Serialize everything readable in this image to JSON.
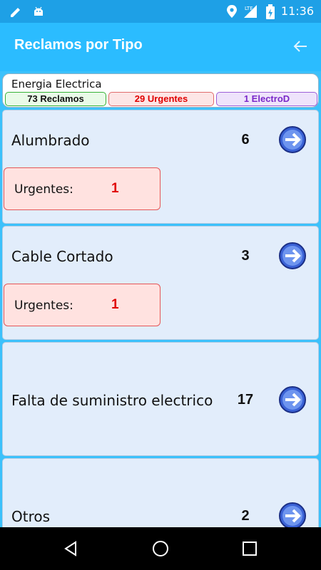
{
  "status_bar": {
    "time": "11:36",
    "network": "LTE"
  },
  "app_bar": {
    "title": "Reclamos por Tipo"
  },
  "summary": {
    "category": "Energia Electrica",
    "total_label": "73 Reclamos",
    "urgent_label": "29 Urgentes",
    "electrod_label": "1 ElectroD"
  },
  "cards": [
    {
      "name": "Alumbrado",
      "count": "6",
      "urgent_label": "Urgentes:",
      "urgent_count": "1"
    },
    {
      "name": "Cable Cortado",
      "count": "3",
      "urgent_label": "Urgentes:",
      "urgent_count": "1"
    },
    {
      "name": "Falta de suministro electrico",
      "count": "17"
    },
    {
      "name": "Otros",
      "count": "2"
    }
  ],
  "colors": {
    "status_bar": "#1ea0e6",
    "app_bar": "#2bbcff",
    "background": "#3cc1fb",
    "urgent": "#e00000",
    "electrod": "#7a28c8"
  },
  "icons": [
    "edit-icon",
    "android-icon",
    "location-icon",
    "signal-icon",
    "battery-icon",
    "back-arrow-icon",
    "go-arrow-icon",
    "nav-back-icon",
    "nav-home-icon",
    "nav-recents-icon"
  ]
}
